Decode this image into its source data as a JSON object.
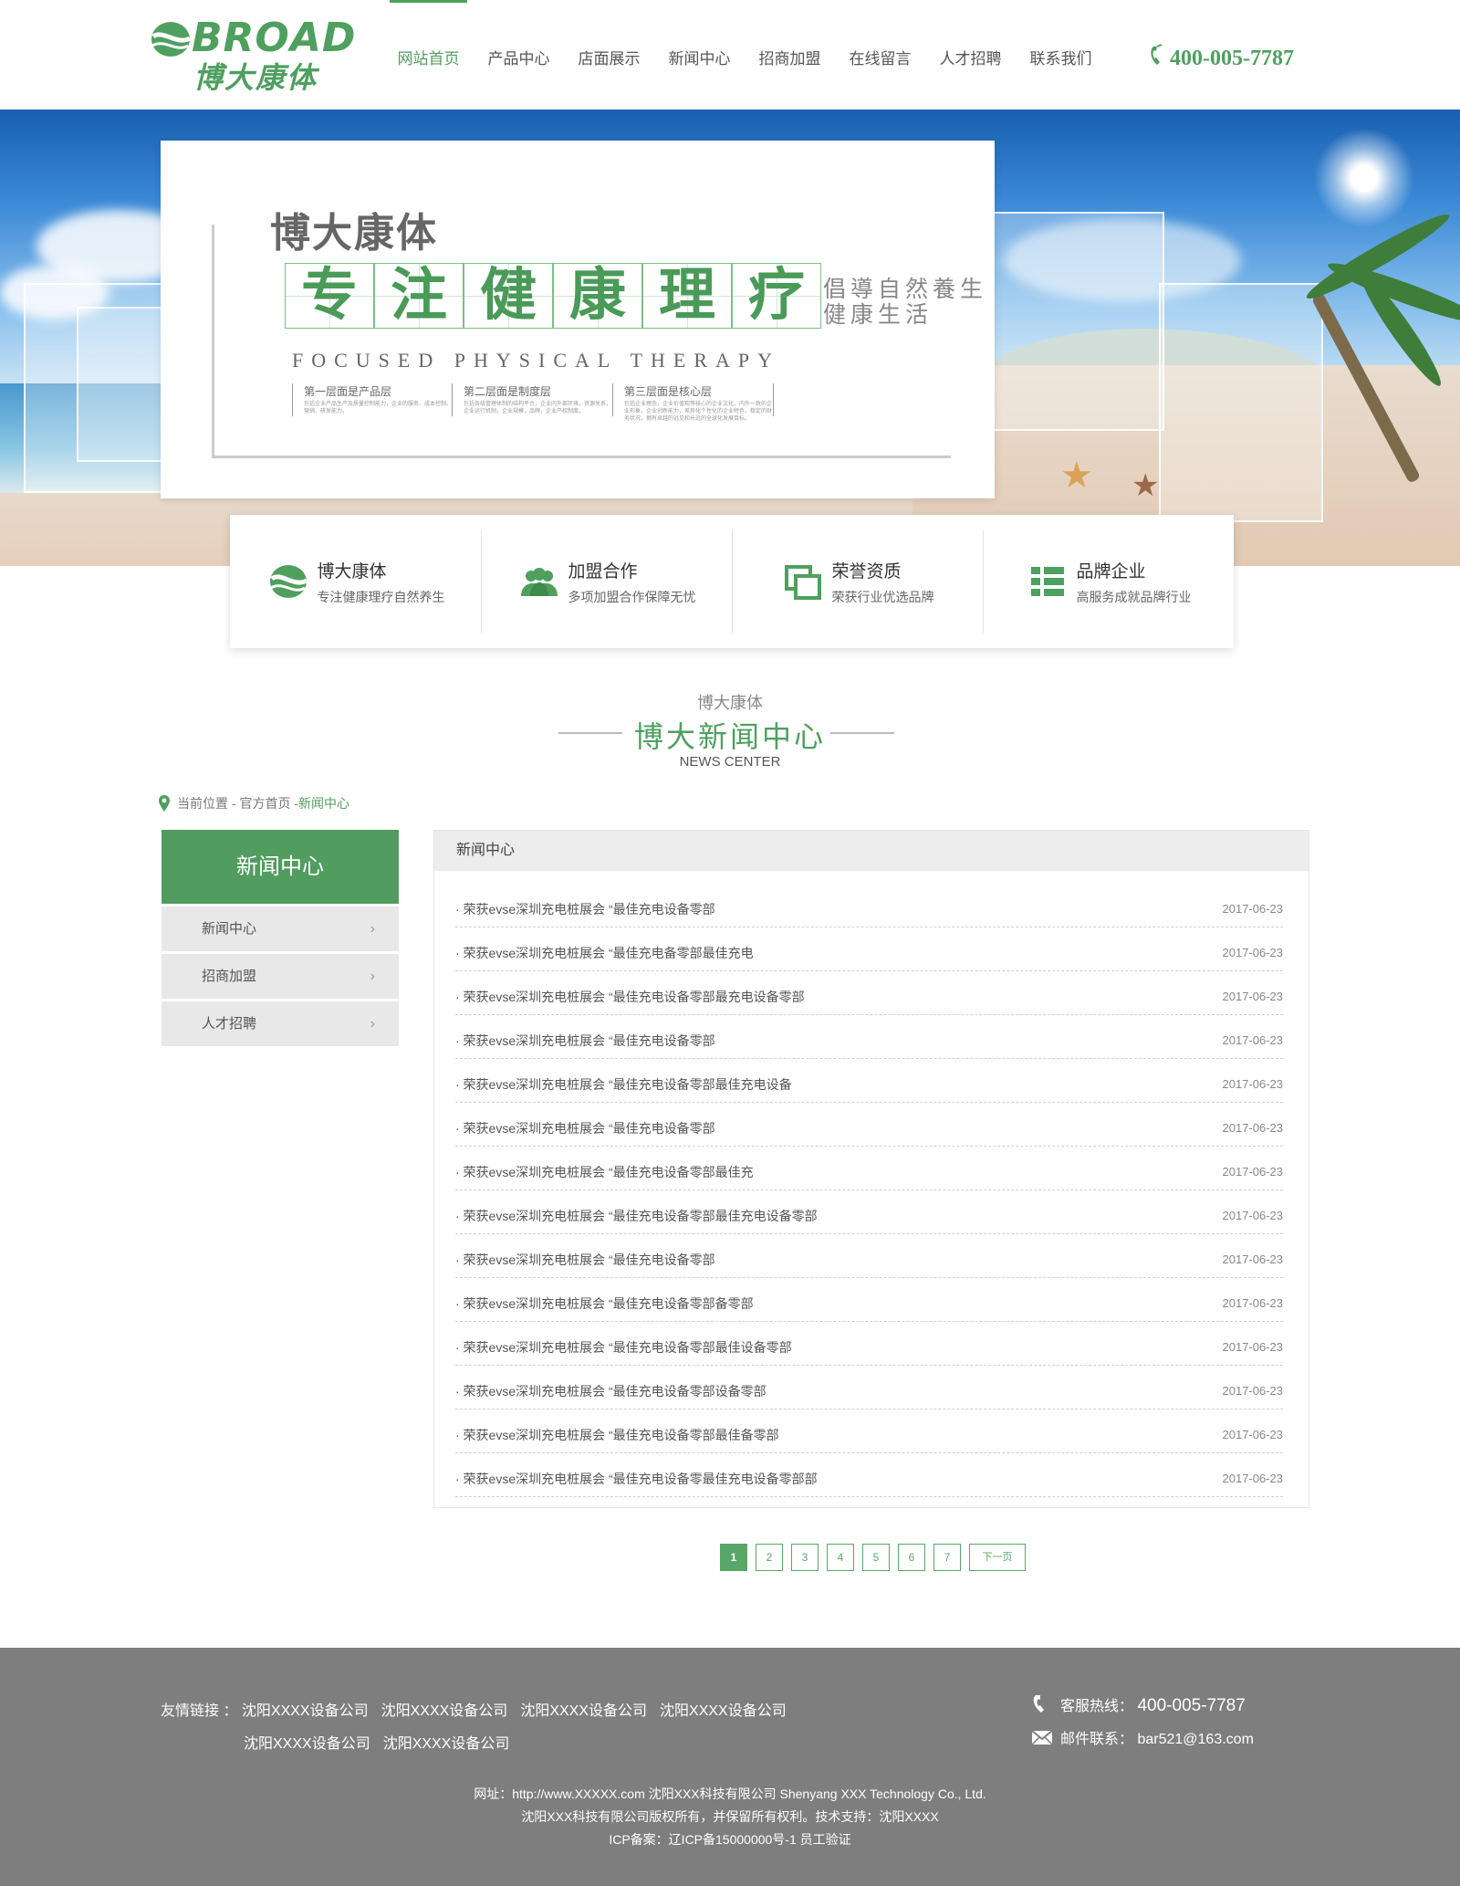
{
  "header": {
    "logo_en": "BROAD",
    "logo_cn": "博大康体",
    "nav": [
      "网站首页",
      "产品中心",
      "店面展示",
      "新闻中心",
      "招商加盟",
      "在线留言",
      "人才招聘",
      "联系我们"
    ],
    "hotline": "400-005-7787",
    "accent_color": "#4f9f5f"
  },
  "banner": {
    "brand": "博大康体",
    "slogan": [
      "专",
      "注",
      "健",
      "康",
      "理",
      "疗"
    ],
    "side_text_1": "倡導自然養生",
    "side_text_2": "健康生活",
    "focused": "FOCUSED PHYSICAL THERAPY",
    "layers": [
      {
        "title": "第一层面是产品层",
        "desc": "包括企业产品生产及质量控制能力，企业的服务、成本控制、营销、研发能力。"
      },
      {
        "title": "第二层面是制度层",
        "desc": "包括各级管理体制的结构平台，企业内外部环境，资源关系，企业运行机制，企业规模，品牌，企业产权制度。"
      },
      {
        "title": "第三层面是核心层",
        "desc": "包括企业理念，企业价值观等核心的企业文化，内外一致的企业形象，企业创新能力，差异化个性化的企业特色，稳定的财务状况，拥有卓越的远见和长远的全球化发展目标。"
      }
    ]
  },
  "features": [
    {
      "icon": "logo-icon",
      "title": "博大康体",
      "desc": "专注健康理疗自然养生"
    },
    {
      "icon": "team-icon",
      "title": "加盟合作",
      "desc": "多项加盟合作保障无忧"
    },
    {
      "icon": "certificate-icon",
      "title": "荣誉资质",
      "desc": "荣获行业优选品牌"
    },
    {
      "icon": "grid-list-icon",
      "title": "品牌企业",
      "desc": "高服务成就品牌行业"
    }
  ],
  "section": {
    "sub": "博大康体",
    "title": "博大新闻中心",
    "en": "NEWS CENTER"
  },
  "breadcrumb": {
    "label": "当前位置 - 官方首页 - ",
    "current": "新闻中心"
  },
  "sidebar": {
    "title": "新闻中心",
    "items": [
      "新闻中心",
      "招商加盟",
      "人才招聘"
    ]
  },
  "news": {
    "heading": "新闻中心",
    "items": [
      {
        "title": "· 荣获evse深圳充电桩展会 “最佳充电设备零部",
        "date": "2017-06-23"
      },
      {
        "title": "· 荣获evse深圳充电桩展会 “最佳充电备零部最佳充电",
        "date": "2017-06-23"
      },
      {
        "title": "· 荣获evse深圳充电桩展会 “最佳充电设备零部最充电设备零部",
        "date": "2017-06-23"
      },
      {
        "title": "· 荣获evse深圳充电桩展会 “最佳充电设备零部",
        "date": "2017-06-23"
      },
      {
        "title": "· 荣获evse深圳充电桩展会 “最佳充电设备零部最佳充电设备",
        "date": "2017-06-23"
      },
      {
        "title": "· 荣获evse深圳充电桩展会 “最佳充电设备零部",
        "date": "2017-06-23"
      },
      {
        "title": "· 荣获evse深圳充电桩展会 “最佳充电设备零部最佳充",
        "date": "2017-06-23"
      },
      {
        "title": "· 荣获evse深圳充电桩展会 “最佳充电设备零部最佳充电设备零部",
        "date": "2017-06-23"
      },
      {
        "title": "· 荣获evse深圳充电桩展会 “最佳充电设备零部",
        "date": "2017-06-23"
      },
      {
        "title": "· 荣获evse深圳充电桩展会 “最佳充电设备零部备零部",
        "date": "2017-06-23"
      },
      {
        "title": "· 荣获evse深圳充电桩展会 “最佳充电设备零部最佳设备零部",
        "date": "2017-06-23"
      },
      {
        "title": "· 荣获evse深圳充电桩展会 “最佳充电设备零部设备零部",
        "date": "2017-06-23"
      },
      {
        "title": "· 荣获evse深圳充电桩展会 “最佳充电设备零部最佳备零部",
        "date": "2017-06-23"
      },
      {
        "title": "· 荣获evse深圳充电桩展会 “最佳充电设备零最佳充电设备零部部",
        "date": "2017-06-23"
      }
    ]
  },
  "pagination": {
    "pages": [
      "1",
      "2",
      "3",
      "4",
      "5",
      "6",
      "7"
    ],
    "current": "1",
    "next": "下一页"
  },
  "footer": {
    "links_label": "友情链接 ：",
    "links_row1": [
      "沈阳XXXX设备公司",
      "沈阳XXXX设备公司",
      "沈阳XXXX设备公司",
      "沈阳XXXX设备公司"
    ],
    "links_row2": [
      "沈阳XXXX设备公司",
      "沈阳XXXX设备公司"
    ],
    "hotline_label": "客服热线：",
    "hotline": "400-005-7787",
    "email_label": "邮件联系：",
    "email": "bar521@163.com",
    "address": "网址：http://www.XXXXX.com 沈阳XXX科技有限公司 Shenyang XXX Technology Co., Ltd.",
    "copyright": "沈阳XXX科技有限公司版权所有，并保留所有权利。技术支持：沈阳XXXX",
    "icp": "ICP备案：辽ICP备15000000号-1 员工验证"
  }
}
